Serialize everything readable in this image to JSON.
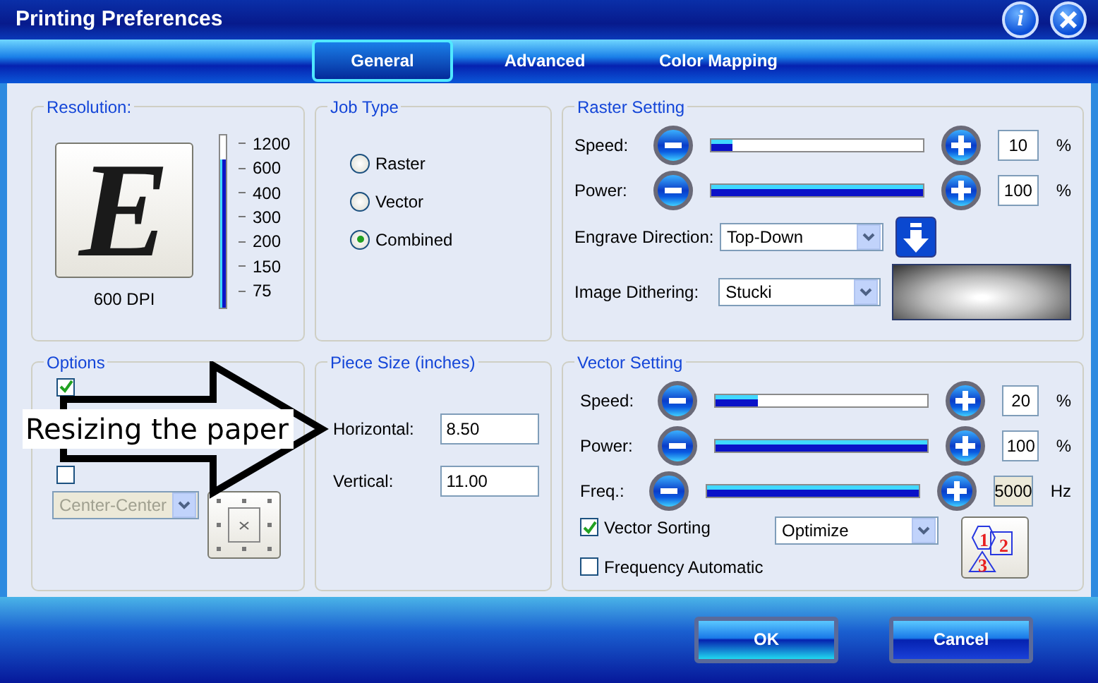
{
  "window": {
    "title": "Printing Preferences",
    "help_label": "i"
  },
  "tabs": [
    {
      "label": "General",
      "selected": true
    },
    {
      "label": "Advanced",
      "selected": false
    },
    {
      "label": "Color Mapping",
      "selected": false
    }
  ],
  "resolution": {
    "title": "Resolution:",
    "preview_letter": "E",
    "dpi": "600 DPI",
    "level": 0.86,
    "marks": [
      "1200",
      "600",
      "400",
      "300",
      "200",
      "150",
      "75"
    ]
  },
  "job_type": {
    "title": "Job Type",
    "options": [
      {
        "label": "Raster",
        "selected": false
      },
      {
        "label": "Vector",
        "selected": false
      },
      {
        "label": "Combined",
        "selected": true
      }
    ]
  },
  "raster": {
    "title": "Raster Setting",
    "sliders": [
      {
        "label": "Speed:",
        "level": 0.1,
        "value": "10",
        "unit": "%",
        "editable": true
      },
      {
        "label": "Power:",
        "level": 1,
        "value": "100",
        "unit": "%",
        "editable": true
      }
    ],
    "engrave_direction": {
      "label": "Engrave Direction:",
      "value": "Top-Down"
    },
    "dithering": {
      "label": "Image Dithering:",
      "value": "Stucki"
    }
  },
  "options": {
    "title": "Options",
    "checkboxes": [
      {
        "checked": true
      },
      {
        "checked": false
      }
    ],
    "position": {
      "value": "Center-Center",
      "disabled": true
    }
  },
  "piece_size": {
    "title": "Piece Size (inches)",
    "fields": [
      {
        "label": "Horizontal:",
        "value": "8.50"
      },
      {
        "label": "Vertical:",
        "value": "11.00"
      }
    ]
  },
  "vector": {
    "title": "Vector Setting",
    "sliders": [
      {
        "label": "Speed:",
        "level": 0.2,
        "value": "20",
        "unit": "%",
        "editable": true
      },
      {
        "label": "Power:",
        "level": 1,
        "value": "100",
        "unit": "%",
        "editable": true
      },
      {
        "label": "Freq.:",
        "level": 1,
        "value": "5000",
        "unit": "Hz",
        "editable": false
      }
    ],
    "sorting": {
      "label": "Vector Sorting",
      "checked": true,
      "mode": "Optimize",
      "order_labels": [
        "1",
        "2",
        "3"
      ]
    },
    "frequency_auto": {
      "label": "Frequency Automatic",
      "checked": false
    }
  },
  "callout": {
    "text": "Resizing the paper"
  },
  "buttons": [
    "OK",
    "Cancel"
  ]
}
